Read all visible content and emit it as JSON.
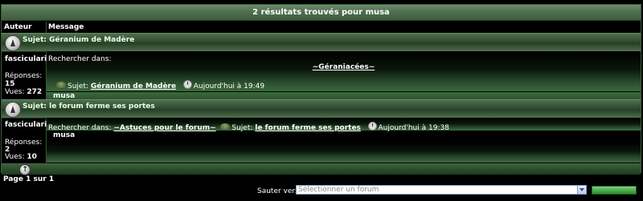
{
  "header": {
    "title": "2 résultats trouvés pour musa"
  },
  "columns": {
    "author": "Auteur",
    "message": "Message"
  },
  "results": [
    {
      "topic_title": "Sujet: Géranium de Madère",
      "author": "fascicularia",
      "replies_label": "Réponses:",
      "replies": "15",
      "views_label": "Vues:",
      "views": "272",
      "search_in_label": "Rechercher dans:",
      "forum": "~Géraniacées~",
      "subject_label": "Sujet:",
      "subject": "Géranium de Madère",
      "date": "Aujourd'hui à 19:49",
      "poster": "musa"
    },
    {
      "topic_title": "Sujet: le forum ferme ses portes",
      "author": "fascicularia",
      "replies_label": "Réponses:",
      "replies": "2",
      "views_label": "Vues:",
      "views": "10",
      "search_in_label": "Rechercher dans:",
      "forum": "~Astuces pour le forum~",
      "subject_label": "Sujet:",
      "subject": "le forum ferme ses portes",
      "date": "Aujourd'hui à 19:38",
      "poster": "musa"
    }
  ],
  "pagination": "Page 1 sur 1",
  "jump": {
    "label": "Sauter vers:",
    "select_value": "Sélectionner un forum",
    "go_label": ""
  },
  "icons": {
    "topic": "topic-folder-icon",
    "post": "turtle-post-icon",
    "time": "clock-icon",
    "top": "back-to-top-icon"
  }
}
